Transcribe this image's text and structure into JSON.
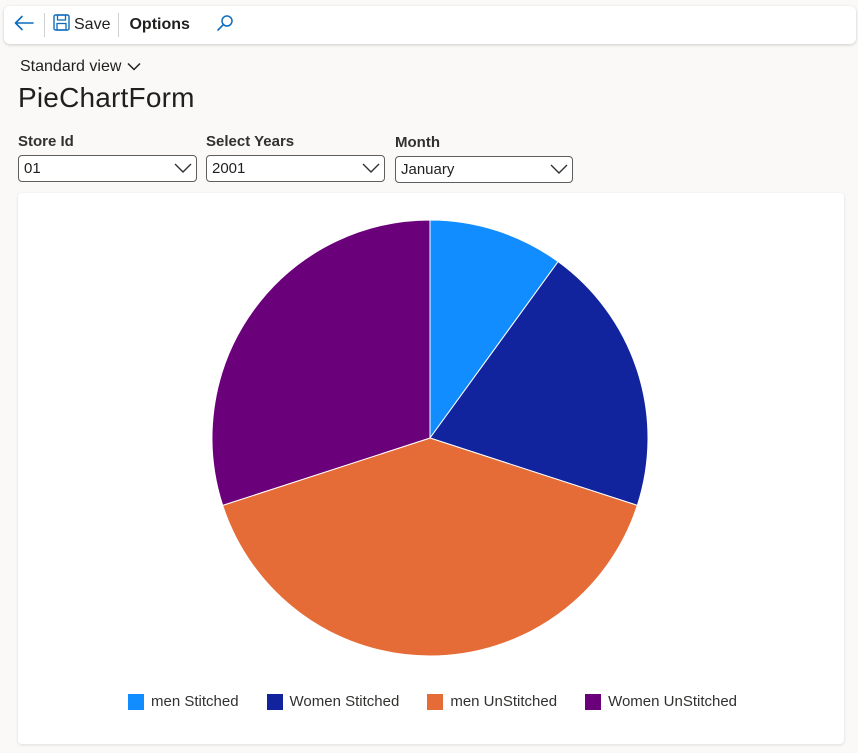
{
  "toolbar": {
    "save_label": "Save",
    "options_label": "Options"
  },
  "view": {
    "label": "Standard view"
  },
  "page": {
    "title": "PieChartForm"
  },
  "filters": {
    "store": {
      "label": "Store Id",
      "value": "01"
    },
    "years": {
      "label": "Select Years",
      "value": "2001"
    },
    "month": {
      "label": "Month",
      "value": "January"
    }
  },
  "colors": {
    "accent": "#0f6cbd"
  },
  "icons": [
    "back-arrow-icon",
    "save-icon",
    "search-icon",
    "chevron-down-icon"
  ],
  "chart_data": {
    "type": "pie",
    "categories": [
      "men Stitched",
      "Women Stitched",
      "men UnStitched",
      "Women UnStitched"
    ],
    "values": [
      10,
      20,
      40,
      30
    ],
    "colors": [
      "#118dff",
      "#12239e",
      "#e66c37",
      "#6b007b"
    ],
    "legend_position": "bottom"
  }
}
